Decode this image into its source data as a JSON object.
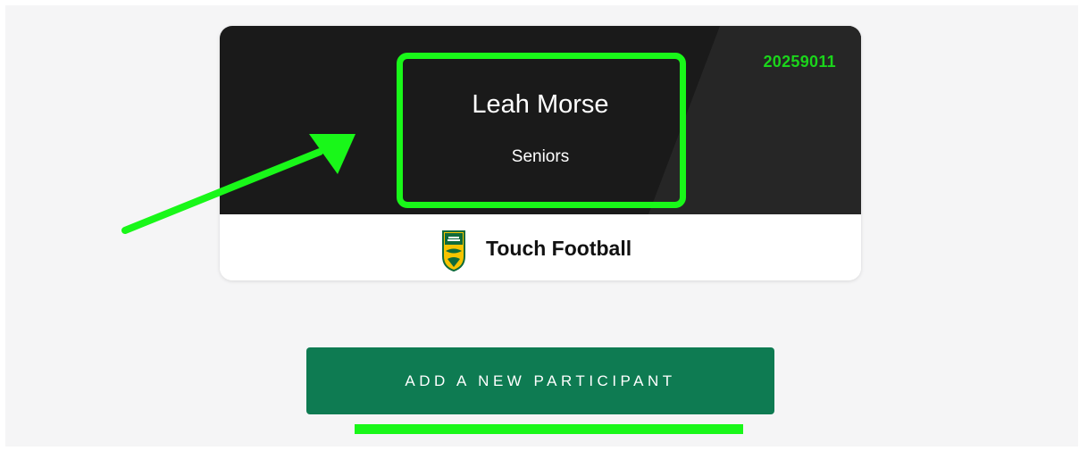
{
  "participant_card": {
    "id": "20259011",
    "name": "Leah Morse",
    "division": "Seniors",
    "sport": {
      "name": "Touch Football",
      "logo_icon": "touch-football-shield-logo"
    }
  },
  "actions": {
    "add_participant_label": "ADD A NEW PARTICIPANT"
  },
  "annotations": {
    "highlight_color": "#19f719",
    "arrow_icon": "arrow-pointing-right-up"
  },
  "colors": {
    "card_dark": "#1a1a1a",
    "id_green": "#1bd41b",
    "button_green": "#0e7b52",
    "page_bg": "#f5f5f6"
  }
}
